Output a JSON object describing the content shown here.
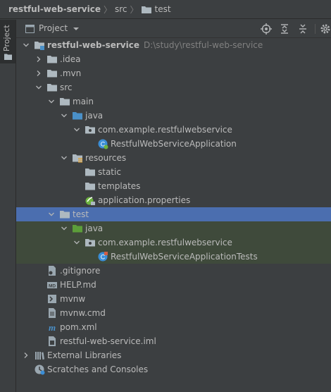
{
  "breadcrumb": {
    "project": "restful-web-service",
    "folder1": "src",
    "folder2": "test"
  },
  "strip": {
    "tab_label": "Project"
  },
  "panel": {
    "title": "Project",
    "tools": [
      "locate-icon",
      "expand-all-icon",
      "collapse-all-icon",
      "settings-icon"
    ]
  },
  "tree": [
    {
      "label": "restful-web-service",
      "path": "D:\\study\\restful-web-service",
      "icon": "module-folder-icon",
      "arrow": "down"
    },
    {
      "label": ".idea",
      "icon": "folder-icon",
      "arrow": "right"
    },
    {
      "label": ".mvn",
      "icon": "folder-icon",
      "arrow": "right"
    },
    {
      "label": "src",
      "icon": "folder-icon",
      "arrow": "down"
    },
    {
      "label": "main",
      "icon": "folder-icon",
      "arrow": "down"
    },
    {
      "label": "java",
      "icon": "source-folder-icon",
      "arrow": "down"
    },
    {
      "label": "com.example.restfulwebservice",
      "icon": "package-icon",
      "arrow": "down"
    },
    {
      "label": "RestfulWebServiceApplication",
      "icon": "spring-class-icon",
      "arrow": "none"
    },
    {
      "label": "resources",
      "icon": "resources-folder-icon",
      "arrow": "down"
    },
    {
      "label": "static",
      "icon": "folder-icon",
      "arrow": "none"
    },
    {
      "label": "templates",
      "icon": "folder-icon",
      "arrow": "none"
    },
    {
      "label": "application.properties",
      "icon": "spring-properties-icon",
      "arrow": "none"
    },
    {
      "label": "test",
      "icon": "folder-icon",
      "arrow": "down",
      "state": "selected"
    },
    {
      "label": "java",
      "icon": "test-folder-icon",
      "arrow": "down",
      "state": "test"
    },
    {
      "label": "com.example.restfulwebservice",
      "icon": "package-icon",
      "arrow": "down",
      "state": "test"
    },
    {
      "label": "RestfulWebServiceApplicationTests",
      "icon": "test-class-icon",
      "arrow": "none",
      "state": "test"
    },
    {
      "label": ".gitignore",
      "icon": "gitignore-file-icon",
      "arrow": "none"
    },
    {
      "label": "HELP.md",
      "icon": "markdown-file-icon",
      "arrow": "none"
    },
    {
      "label": "mvnw",
      "icon": "shell-file-icon",
      "arrow": "none"
    },
    {
      "label": "mvnw.cmd",
      "icon": "cmd-file-icon",
      "arrow": "none"
    },
    {
      "label": "pom.xml",
      "icon": "maven-file-icon",
      "arrow": "none"
    },
    {
      "label": "restful-web-service.iml",
      "icon": "iml-file-icon",
      "arrow": "none"
    },
    {
      "label": "External Libraries",
      "icon": "libraries-icon",
      "arrow": "right"
    },
    {
      "label": "Scratches and Consoles",
      "icon": "scratches-icon",
      "arrow": "none"
    }
  ],
  "colors": {
    "background": "#3c3f41",
    "selection": "#4b6eaf",
    "test_highlight": "#3f4a3b",
    "folder": "#aeb9c0",
    "source_folder": "#4a90c8",
    "test_folder": "#5c9e3a",
    "text": "#bbbbbb"
  }
}
